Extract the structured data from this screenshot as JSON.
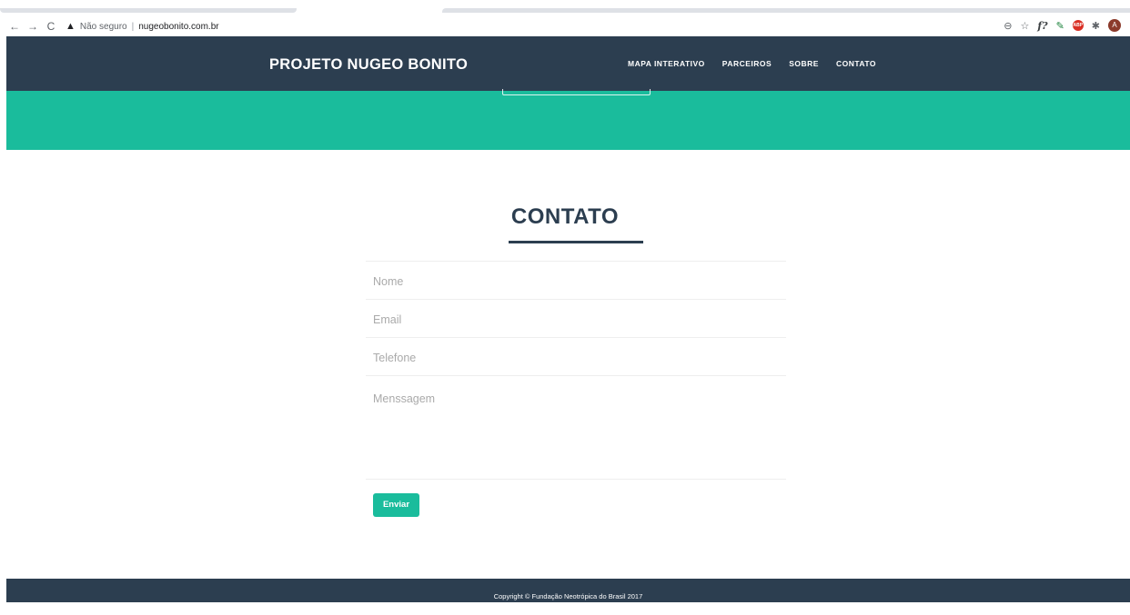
{
  "browser": {
    "back_icon": "arrow-left-icon",
    "forward_icon": "arrow-right-icon",
    "reload_icon": "reload-icon",
    "security_label": "Não seguro",
    "url": "nugeobonito.com.br",
    "extension_icons": [
      "zoom-icon",
      "star-icon",
      "formula-icon",
      "pen-icon",
      "adblock-icon",
      "puzzle-icon",
      "avatar-icon"
    ],
    "avatar_letter": "A"
  },
  "site": {
    "brand": "PROJETO NUGEO BONITO",
    "menu": [
      "MAPA INTERATIVO",
      "PARCEIROS",
      "SOBRE",
      "CONTATO"
    ],
    "colors": {
      "navbar": "#2c3e50",
      "accent": "#1abc9c"
    }
  },
  "contact": {
    "title": "CONTATO",
    "fields": {
      "name_placeholder": "Nome",
      "email_placeholder": "Email",
      "phone_placeholder": "Telefone",
      "message_placeholder": "Menssagem"
    },
    "submit_label": "Enviar"
  },
  "footer": {
    "copyright": "Copyright © Fundação Neotrópica do Brasil 2017"
  }
}
